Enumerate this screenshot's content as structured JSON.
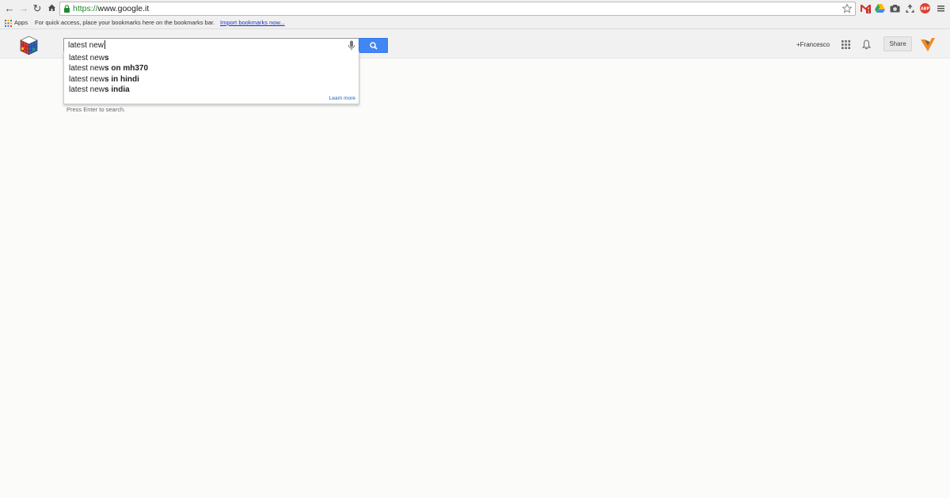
{
  "browser": {
    "url_scheme": "https://",
    "url_rest": "www.google.it",
    "bookmarks": {
      "apps_label": "Apps",
      "hint": "For quick access, place your bookmarks here on the bookmarks bar.",
      "import_link": "Import bookmarks now..."
    },
    "extensions": [
      "gmail-icon",
      "drive-icon",
      "camera-icon",
      "recycle-icon",
      "adblock-icon",
      "menu-icon"
    ],
    "extension_badges": {
      "gmail": "1",
      "adblock": "ABP"
    }
  },
  "google": {
    "search_value": "latest new",
    "user_label": "+Francesco",
    "share_label": "Share",
    "suggestions": [
      {
        "prefix": "latest new",
        "suffix": "s"
      },
      {
        "prefix": "latest new",
        "suffix": "s on mh370"
      },
      {
        "prefix": "latest new",
        "suffix": "s in hindi"
      },
      {
        "prefix": "latest new",
        "suffix": "s india"
      }
    ],
    "learn_more": "Learn more",
    "press_enter": "Press Enter to search."
  },
  "colors": {
    "search_button": "#4285f4",
    "url_scheme": "#1f8a2b",
    "link": "#1a33cc"
  }
}
